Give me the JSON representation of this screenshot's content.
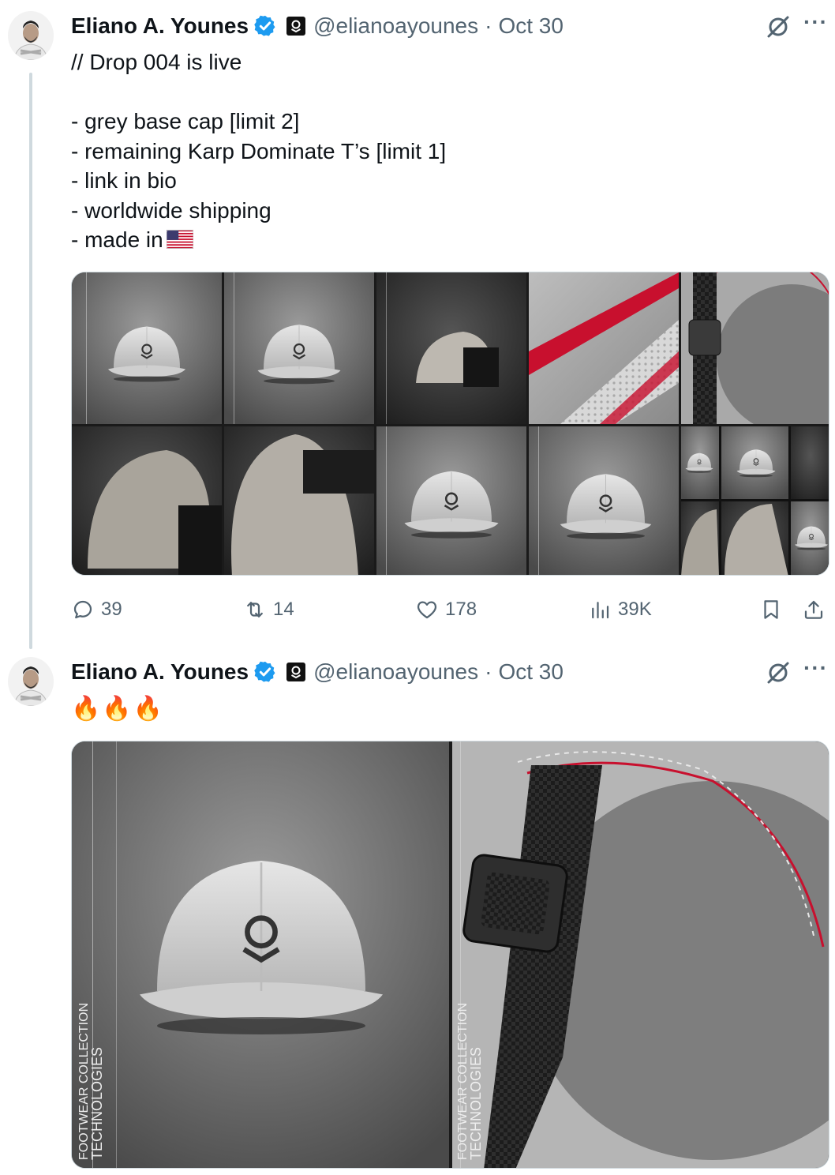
{
  "thread": [
    {
      "author": {
        "name": "Eliano A. Younes",
        "handle": "@elianoayounes",
        "date": "Oct 30"
      },
      "text_lines": [
        "// Drop 004 is live",
        "",
        "- grey base cap [limit 2]",
        "- remaining Karp Dominate T’s [limit 1]",
        "- link in bio",
        "- worldwide shipping",
        "- made in"
      ],
      "flag": "us-flag",
      "media_count": 10,
      "metrics": {
        "replies": "39",
        "reposts": "14",
        "likes": "178",
        "views": "39K"
      }
    },
    {
      "author": {
        "name": "Eliano A. Younes",
        "handle": "@elianoayounes",
        "date": "Oct 30"
      },
      "emoji": [
        "🔥",
        "🔥",
        "🔥"
      ],
      "media_count": 2
    }
  ],
  "icons": {
    "verified": "verified-badge-icon",
    "affiliate": "palantir-affiliate-icon",
    "grok": "grok-icon",
    "more": "more-icon",
    "reply": "reply-icon",
    "repost": "repost-icon",
    "like": "heart-icon",
    "views": "views-icon",
    "bookmark": "bookmark-icon",
    "share": "share-icon"
  },
  "colors": {
    "verified": "#1d9bf0",
    "muted": "#536471",
    "text": "#0f1419",
    "border": "#cfd9de",
    "accent_red": "#c8102e"
  }
}
